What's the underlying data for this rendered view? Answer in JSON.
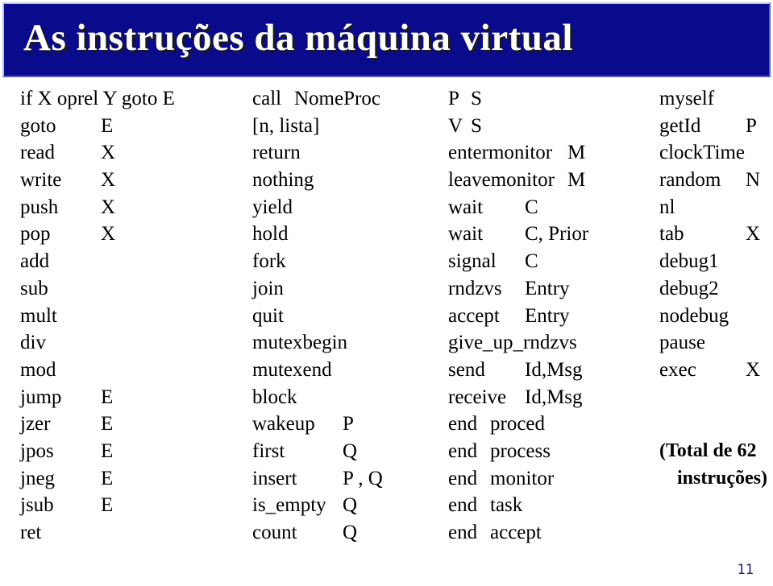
{
  "slide": {
    "title": "As instruções da máquina virtual",
    "page_number": "11",
    "banner_color": "#0A0A8C",
    "page_number_color": "#1F1F6E",
    "title_color": "#ffffff"
  },
  "columns": [
    {
      "id": "col-1",
      "rows": [
        {
          "op": "if X oprel Y goto E",
          "arg": ""
        },
        {
          "op": "goto",
          "arg": "E"
        },
        {
          "op": "read",
          "arg": "X"
        },
        {
          "op": "write",
          "arg": "X"
        },
        {
          "op": "push",
          "arg": "X"
        },
        {
          "op": "pop",
          "arg": "X"
        },
        {
          "op": "add",
          "arg": ""
        },
        {
          "op": "sub",
          "arg": ""
        },
        {
          "op": "mult",
          "arg": ""
        },
        {
          "op": "div",
          "arg": ""
        },
        {
          "op": "mod",
          "arg": ""
        },
        {
          "op": "jump",
          "arg": "E"
        },
        {
          "op": "jzer",
          "arg": "E"
        },
        {
          "op": "jpos",
          "arg": "E"
        },
        {
          "op": "jneg",
          "arg": "E"
        },
        {
          "op": "jsub",
          "arg": "E"
        },
        {
          "op": "ret",
          "arg": ""
        }
      ]
    },
    {
      "id": "col-2",
      "rows": [
        {
          "op": "call",
          "arg": "NomeProc",
          "argpos": "mid"
        },
        {
          "op": "[n, lista]",
          "arg": ""
        },
        {
          "op": "return",
          "arg": ""
        },
        {
          "op": "nothing",
          "arg": ""
        },
        {
          "op": "yield",
          "arg": ""
        },
        {
          "op": "hold",
          "arg": ""
        },
        {
          "op": "fork",
          "arg": ""
        },
        {
          "op": "join",
          "arg": ""
        },
        {
          "op": "quit",
          "arg": ""
        },
        {
          "op": "mutexbegin",
          "arg": ""
        },
        {
          "op": "mutexend",
          "arg": ""
        },
        {
          "op": "block",
          "arg": ""
        },
        {
          "op": "wakeup",
          "arg": "P"
        },
        {
          "op": "first",
          "arg": "Q"
        },
        {
          "op": "insert",
          "arg": "P , Q"
        },
        {
          "op": "is_empty",
          "arg": "Q"
        },
        {
          "op": "count",
          "arg": "Q"
        }
      ]
    },
    {
      "id": "col-3",
      "rows": [
        {
          "op": "P",
          "arg": "S",
          "argpos": "near"
        },
        {
          "op": "V",
          "arg": "S",
          "argpos": "near"
        },
        {
          "op": "entermonitor",
          "arg": "M",
          "argpos": "wide"
        },
        {
          "op": "leavemonitor",
          "arg": "M",
          "argpos": "wide"
        },
        {
          "op": "wait",
          "arg": "C"
        },
        {
          "op": "wait",
          "arg": "C, Prior"
        },
        {
          "op": "signal",
          "arg": "C"
        },
        {
          "op": "rndzvs",
          "arg": "Entry"
        },
        {
          "op": "accept",
          "arg": "Entry"
        },
        {
          "op": "give_up_rndzvs",
          "arg": ""
        },
        {
          "op": "send",
          "arg": "Id,Msg"
        },
        {
          "op": "receive",
          "arg": "Id,Msg"
        },
        {
          "op": "end",
          "arg": "proced",
          "argpos": "mid"
        },
        {
          "op": "end",
          "arg": "process",
          "argpos": "mid"
        },
        {
          "op": "end",
          "arg": "monitor",
          "argpos": "mid"
        },
        {
          "op": "end",
          "arg": "task",
          "argpos": "mid"
        },
        {
          "op": "end",
          "arg": "accept",
          "argpos": "mid"
        }
      ]
    },
    {
      "id": "col-4",
      "rows": [
        {
          "op": "myself",
          "arg": ""
        },
        {
          "op": "getId",
          "arg": "P"
        },
        {
          "op": "clockTime",
          "arg": ""
        },
        {
          "op": "random",
          "arg": "N"
        },
        {
          "op": "nl",
          "arg": ""
        },
        {
          "op": "tab",
          "arg": "X"
        },
        {
          "op": "debug1",
          "arg": ""
        },
        {
          "op": "debug2",
          "arg": ""
        },
        {
          "op": "nodebug",
          "arg": ""
        },
        {
          "op": "pause",
          "arg": ""
        },
        {
          "op": "exec",
          "arg": "X"
        },
        {
          "op": "",
          "arg": ""
        },
        {
          "op": "",
          "arg": ""
        },
        {
          "note": "(Total de 62"
        },
        {
          "note": "instruções)",
          "indent": true
        },
        {
          "op": "",
          "arg": ""
        },
        {
          "op": "",
          "arg": ""
        }
      ]
    }
  ]
}
